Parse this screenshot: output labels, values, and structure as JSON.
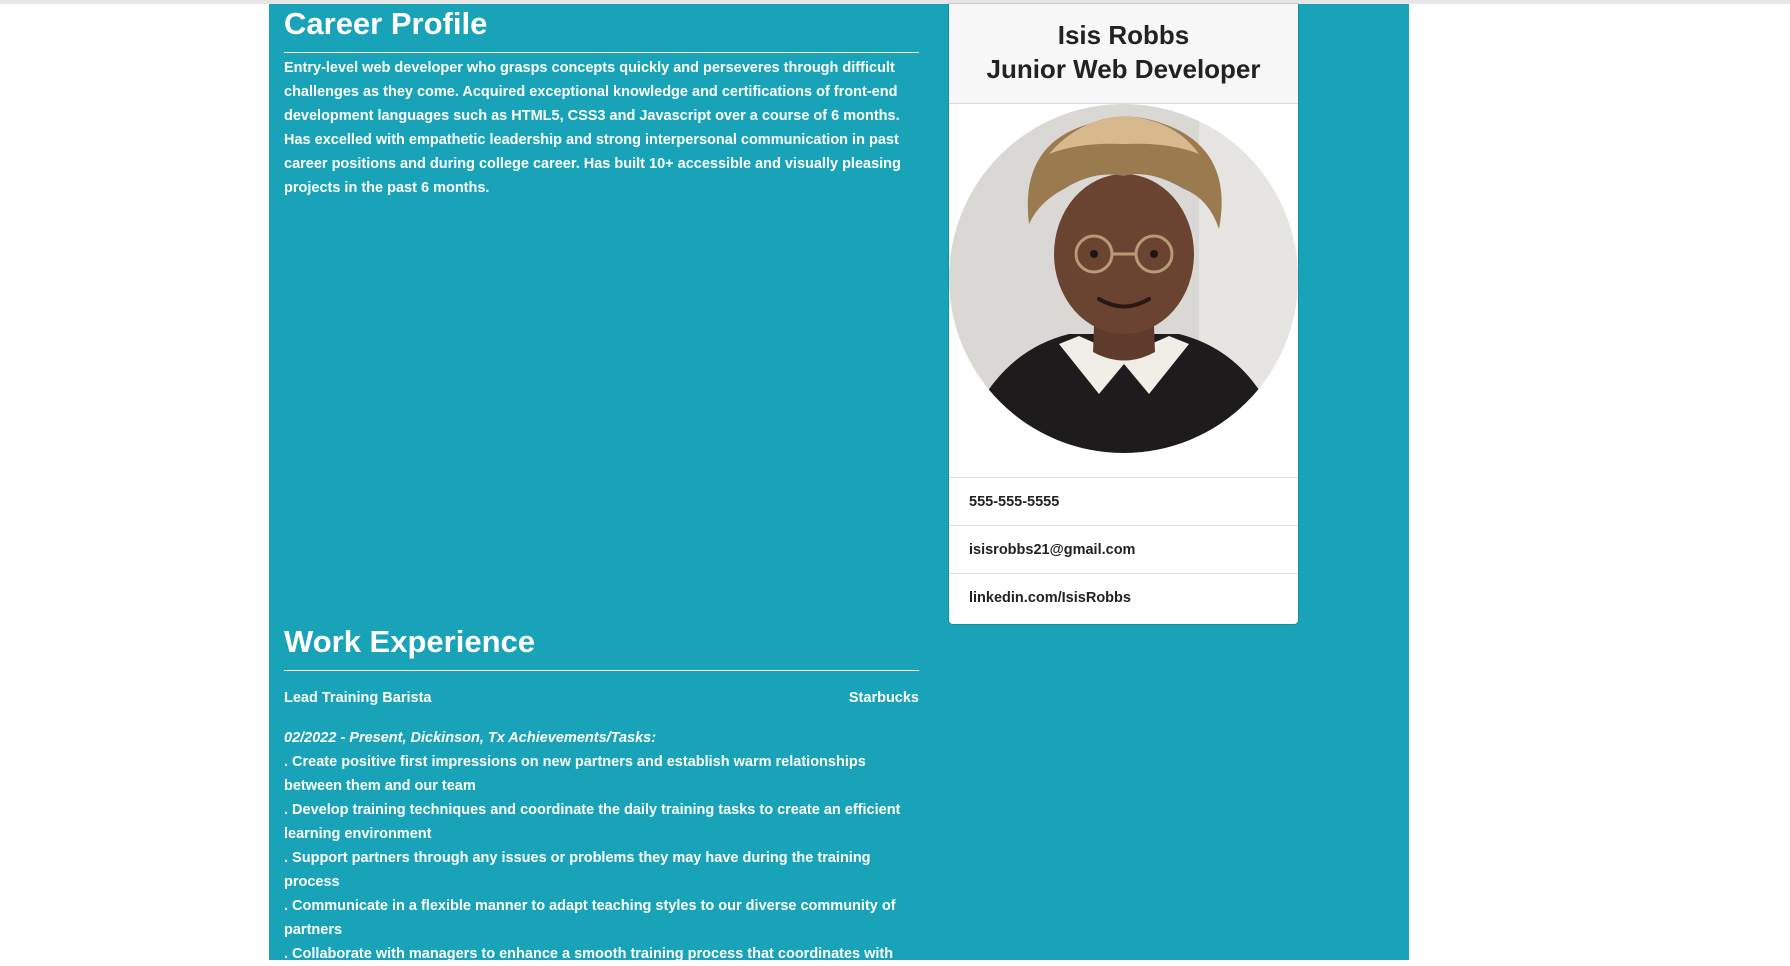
{
  "card": {
    "name": "Isis Robbs",
    "title": "Junior Web Developer",
    "phone": "555-555-5555",
    "email": "isisrobbs21@gmail.com",
    "linkedin": "linkedin.com/IsisRobbs"
  },
  "career_profile": {
    "heading": "Career Profile",
    "text": "Entry-level web developer who grasps concepts quickly and perseveres through difficult challenges as they come. Acquired exceptional knowledge and certifications of front-end development languages such as HTML5, CSS3 and Javascript over a course of 6 months. Has excelled with empathetic leadership and strong interpersonal communication in past career positions and during college career. Has built 10+ accessible and visually pleasing projects in the past 6 months."
  },
  "work_experience": {
    "heading": "Work Experience",
    "job_title": "Lead Training Barista",
    "company": "Starbucks",
    "dates": "02/2022 - Present, Dickinson, Tx Achievements/Tasks:",
    "tasks": [
      ". Create positive first impressions on new partners and establish warm relationships between them and our team",
      ". Develop training techniques and coordinate the daily training tasks to create an efficient learning environment",
      ". Support partners through any issues or problems they may have during the training process",
      ". Communicate in a flexible manner to adapt teaching styles to our diverse community of partners",
      ". Collaborate with managers to enhance a smooth training process that coordinates with"
    ]
  },
  "colors": {
    "panel": "#18a3b9",
    "card_header": "#f7f7f7"
  }
}
